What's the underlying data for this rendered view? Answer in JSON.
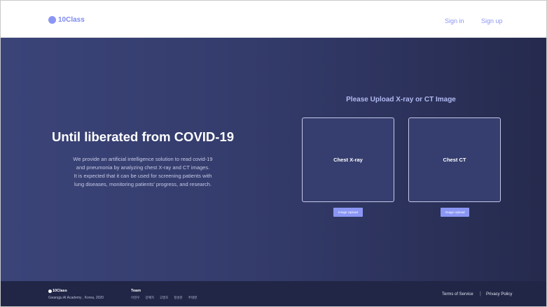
{
  "header": {
    "logo_text": "10Class",
    "sign_in": "Sign in",
    "sign_up": "Sign up"
  },
  "hero": {
    "title": "Until liberated from COVID-19",
    "description_lines": [
      "We provide an artificial intelligence solution to read covid-19",
      "and pneumonia by analyzing chest X-ray and CT images.",
      "It is expected that it can be used for screening patients with",
      "lung diseases, monitoring patients' progress, and research."
    ]
  },
  "upload": {
    "title": "Please Upload X-ray or CT Image",
    "xray_label": "Chest X-ray",
    "ct_label": "Chest CT",
    "xray_button": "Image Upload",
    "ct_button": "Image Upload"
  },
  "footer": {
    "brand": "10Class",
    "address": "Gwangju AI Academy , Korea, 2020",
    "team_title": "Team",
    "members": [
      "이현우",
      "강혜지",
      "고병호",
      "정성훈",
      "주태영"
    ],
    "terms": "Terms of Service",
    "separator": "|",
    "privacy": "Privacy Policy"
  },
  "colors": {
    "accent": "#8b96f4",
    "hero_dark": "#252a4d",
    "hero_light": "#3b4478",
    "footer": "#212646"
  }
}
